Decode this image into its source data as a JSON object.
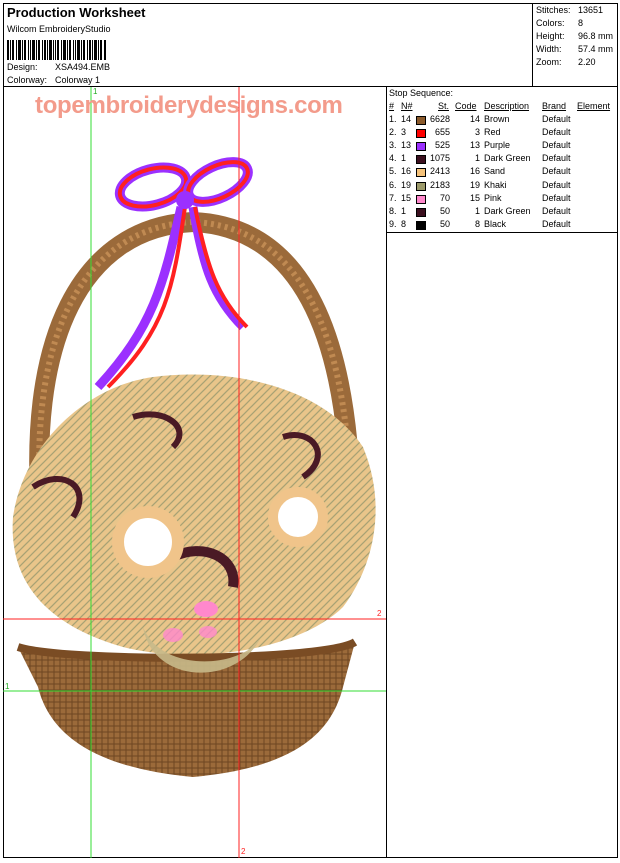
{
  "header": {
    "title": "Production Worksheet",
    "software": "Wilcom EmbroideryStudio",
    "design_label": "Design:",
    "design_value": "XSA494.EMB",
    "colorway_label": "Colorway:",
    "colorway_value": "Colorway 1"
  },
  "stats": {
    "stitches_label": "Stitches:",
    "stitches_value": "13651",
    "colors_label": "Colors:",
    "colors_value": "8",
    "height_label": "Height:",
    "height_value": "96.8 mm",
    "width_label": "Width:",
    "width_value": "57.4 mm",
    "zoom_label": "Zoom:",
    "zoom_value": "2.20"
  },
  "watermark": "topembroiderydesigns.com",
  "axis": {
    "v_green": "1",
    "h_green": "1",
    "v_red": "2",
    "h_red": "2"
  },
  "stop_sequence": {
    "heading": "Stop Sequence:",
    "columns": {
      "num": "#",
      "needle": "N#",
      "stitches": "St.",
      "code": "Code",
      "description": "Description",
      "brand": "Brand",
      "element": "Element"
    },
    "rows": [
      {
        "num": "1.",
        "needle": "14",
        "color": "#8b5a2b",
        "stitches": "6628",
        "code": "14",
        "description": "Brown",
        "brand": "Default"
      },
      {
        "num": "2.",
        "needle": "3",
        "color": "#ff0000",
        "stitches": "655",
        "code": "3",
        "description": "Red",
        "brand": "Default"
      },
      {
        "num": "3.",
        "needle": "13",
        "color": "#9b30ff",
        "stitches": "525",
        "code": "13",
        "description": "Purple",
        "brand": "Default"
      },
      {
        "num": "4.",
        "needle": "1",
        "color": "#3b0f1e",
        "stitches": "1075",
        "code": "1",
        "description": "Dark Green",
        "brand": "Default"
      },
      {
        "num": "5.",
        "needle": "16",
        "color": "#f5c27a",
        "stitches": "2413",
        "code": "16",
        "description": "Sand",
        "brand": "Default"
      },
      {
        "num": "6.",
        "needle": "19",
        "color": "#9c9a6a",
        "stitches": "2183",
        "code": "19",
        "description": "Khaki",
        "brand": "Default"
      },
      {
        "num": "7.",
        "needle": "15",
        "color": "#ff88cc",
        "stitches": "70",
        "code": "15",
        "description": "Pink",
        "brand": "Default"
      },
      {
        "num": "8.",
        "needle": "1",
        "color": "#3b0f1e",
        "stitches": "50",
        "code": "1",
        "description": "Dark Green",
        "brand": "Default"
      },
      {
        "num": "9.",
        "needle": "8",
        "color": "#000000",
        "stitches": "50",
        "code": "8",
        "description": "Black",
        "brand": "Default"
      }
    ]
  }
}
